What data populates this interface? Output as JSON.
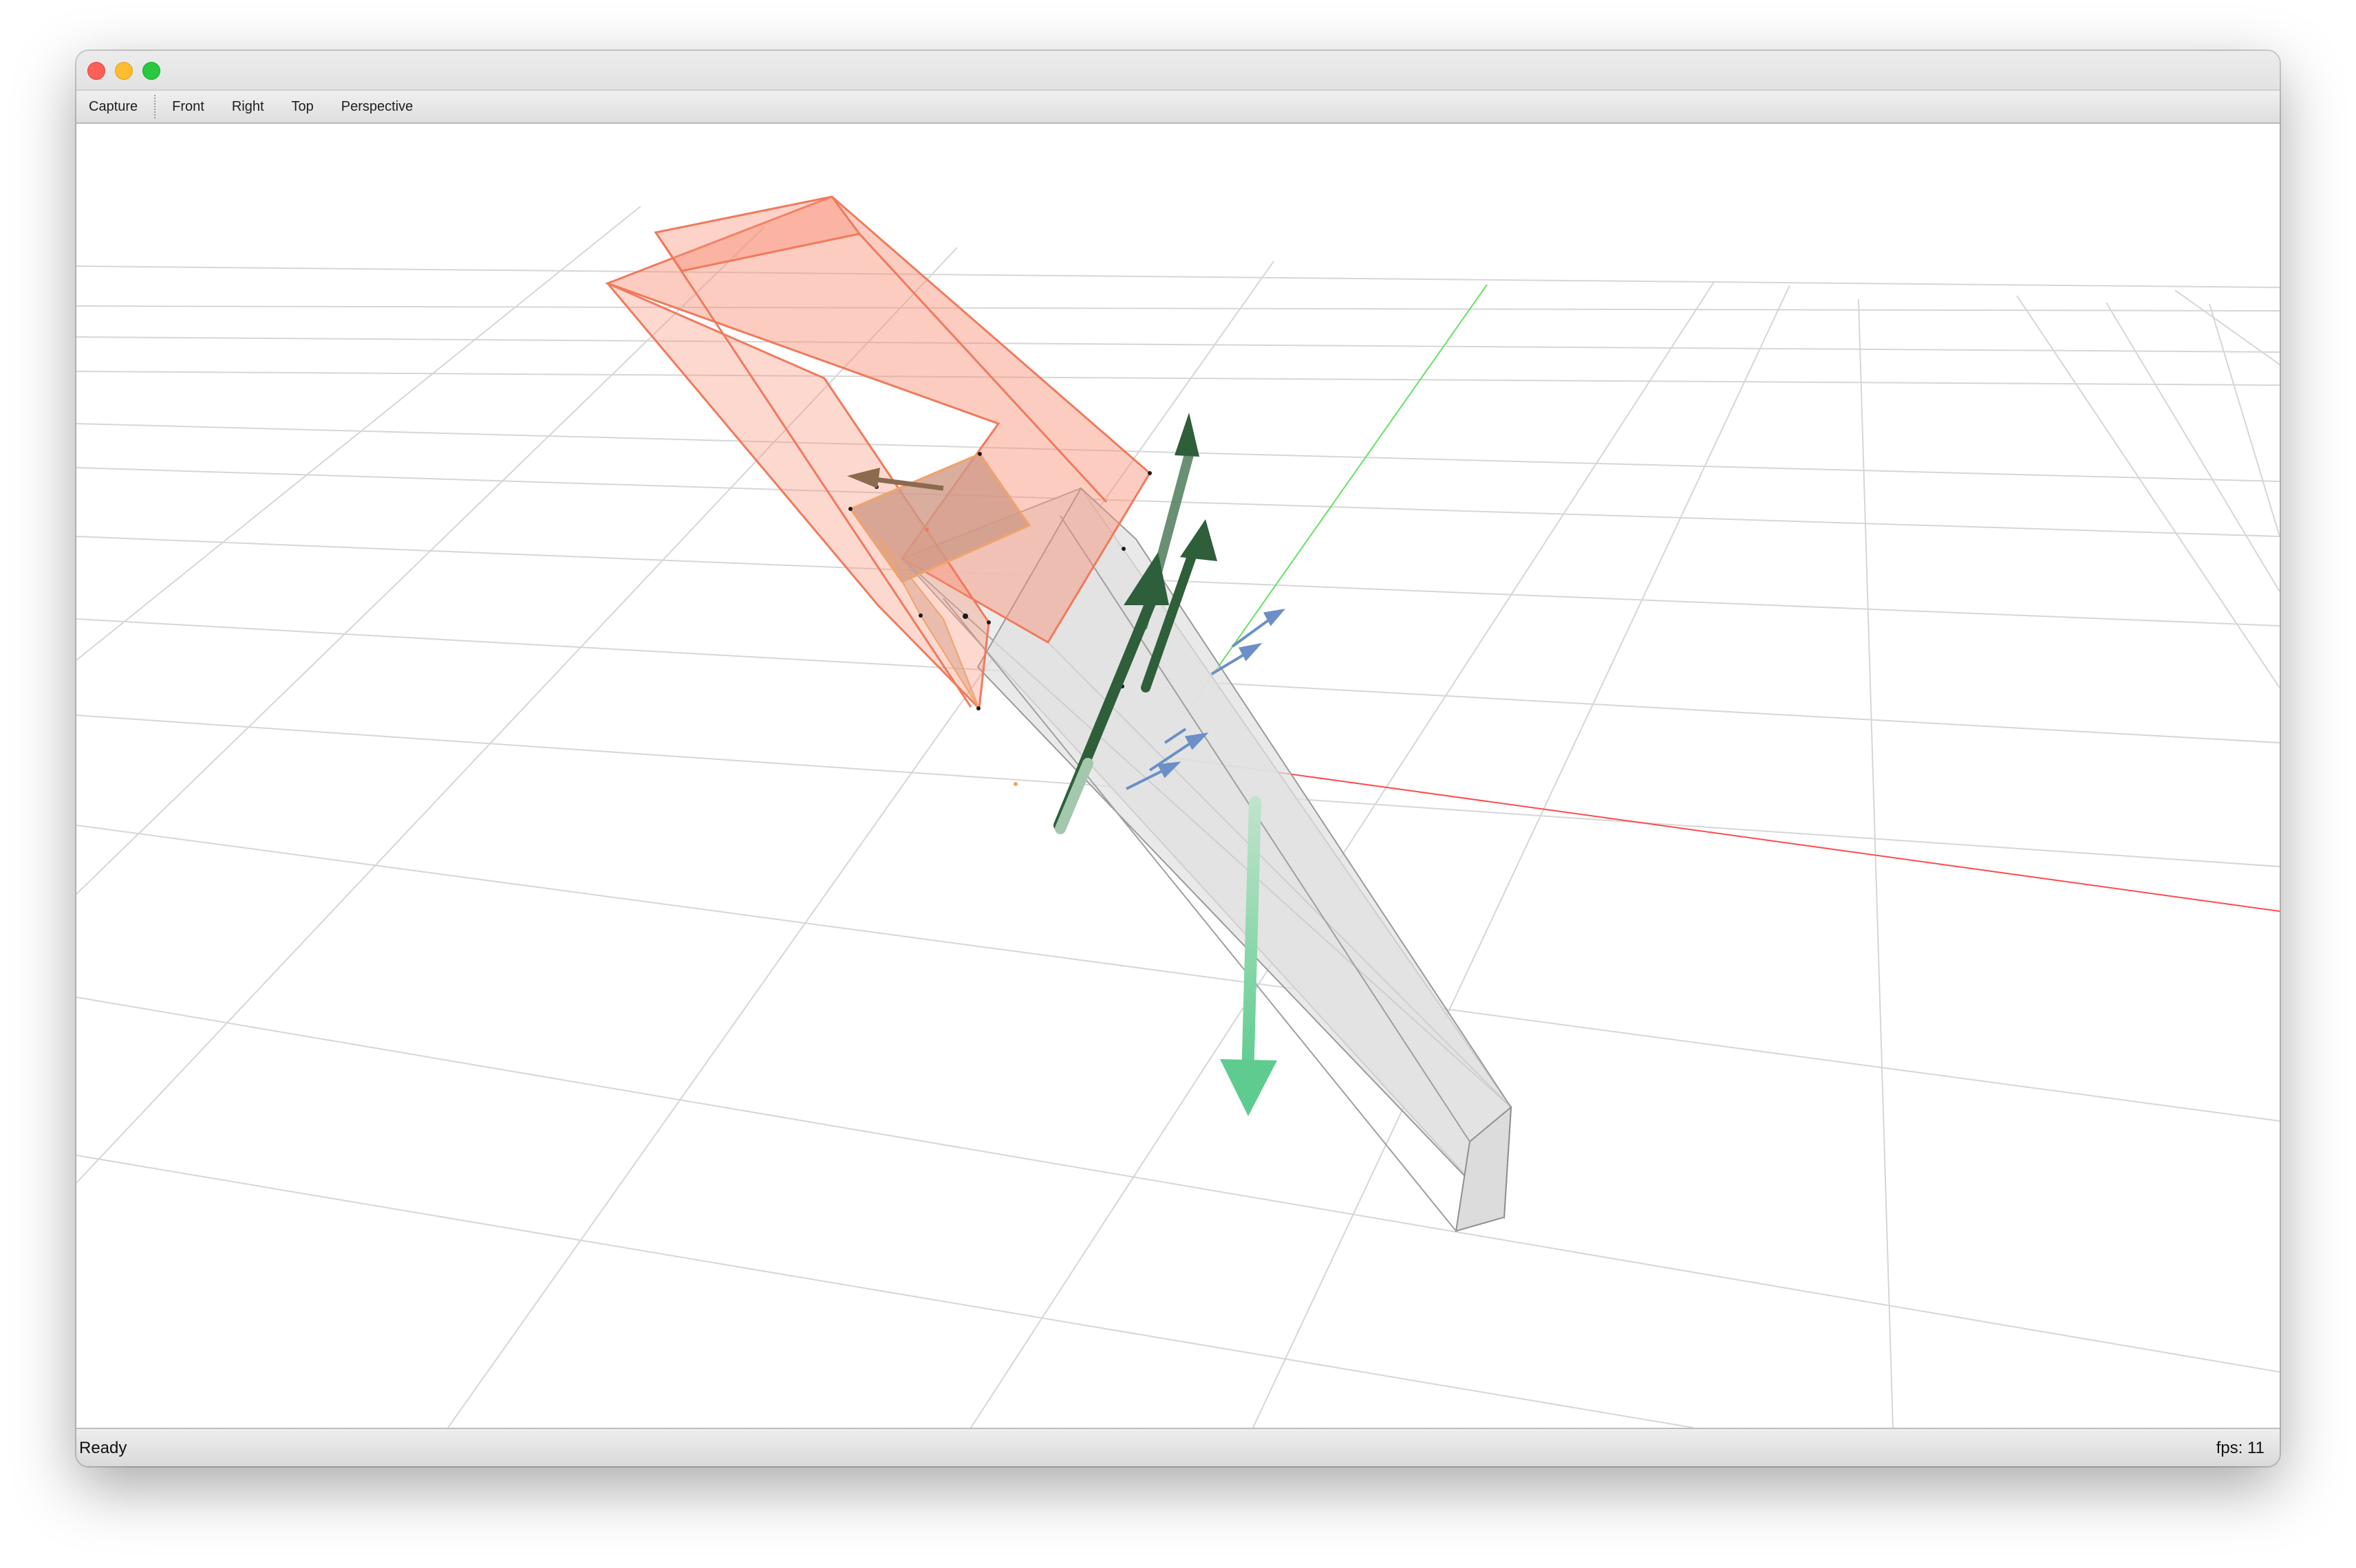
{
  "window": {
    "buttons": [
      "close",
      "minimize",
      "zoom"
    ]
  },
  "toolbar": {
    "capture_label": "Capture",
    "front_label": "Front",
    "right_label": "Right",
    "top_label": "Top",
    "perspective_label": "Perspective"
  },
  "status": {
    "text": "Ready",
    "fps_text": "fps: 11"
  },
  "scene": {
    "colors": {
      "grid": "#d4d4d4",
      "x_axis": "#ff4a4a",
      "y_axis": "#66e066",
      "highlight_box_fill": "#f98f76",
      "highlight_box_stroke": "#f07a5c",
      "gray_box_fill": "#e6e6e6",
      "gray_box_stroke": "#a9a9a9",
      "dark_green_arrow": "#2f5e3a",
      "light_green_arrow": "#5dcc8e",
      "blue_arrow": "#6b8fc6",
      "brown_arrow": "#8b6a4e",
      "vertex_dot": "#1a1a1a"
    },
    "objects": [
      "grid-floor-icon",
      "x-axis-line-icon",
      "y-axis-line-icon",
      "orange-box-icon",
      "gray-box-icon",
      "force-arrow-icon",
      "normal-arrow-icon"
    ]
  }
}
